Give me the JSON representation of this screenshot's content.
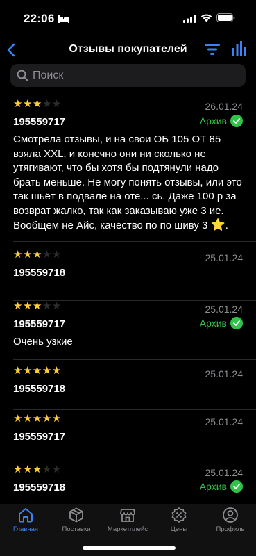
{
  "status": {
    "time": "22:06"
  },
  "header": {
    "title": "Отзывы покупателей"
  },
  "search": {
    "placeholder": "Поиск"
  },
  "colors": {
    "accent": "#3b82f6",
    "archive": "#32c24a",
    "star": "#ffcf36"
  },
  "reviews": [
    {
      "rating": 3,
      "date": "26.01.24",
      "article": "195559717",
      "archive": "Архив",
      "text": "Смотрела отзывы, и на свои ОБ 105 ОТ 85 взяла XXL, и конечно они ни сколько не утягивают, что бы хотя бы подтянули надо брать меньше. Не могу понять отзывы, или это так шьёт в подвале на оте... сь. Даже 100 р за возврат жалко, так как заказываю уже 3 ие. Вообщем не Айс, качество по по шиву 3",
      "text_end": "."
    },
    {
      "rating": 3,
      "date": "25.01.24",
      "article": "195559718",
      "archive": "",
      "text": ""
    },
    {
      "rating": 3,
      "date": "25.01.24",
      "article": "195559717",
      "archive": "Архив",
      "text": "Очень узкие"
    },
    {
      "rating": 5,
      "date": "25.01.24",
      "article": "195559718",
      "archive": "",
      "text": ""
    },
    {
      "rating": 5,
      "date": "25.01.24",
      "article": "195559717",
      "archive": "",
      "text": ""
    },
    {
      "rating": 3,
      "date": "25.01.24",
      "article": "195559718",
      "archive": "Архив",
      "text": ""
    }
  ],
  "tabs": [
    {
      "label": "Главная",
      "icon": "home-icon",
      "active": true
    },
    {
      "label": "Поставки",
      "icon": "box-icon",
      "active": false
    },
    {
      "label": "Маркетплейс",
      "icon": "store-icon",
      "active": false
    },
    {
      "label": "Цены",
      "icon": "percent-badge-icon",
      "active": false
    },
    {
      "label": "Профиль",
      "icon": "profile-icon",
      "active": false
    }
  ]
}
